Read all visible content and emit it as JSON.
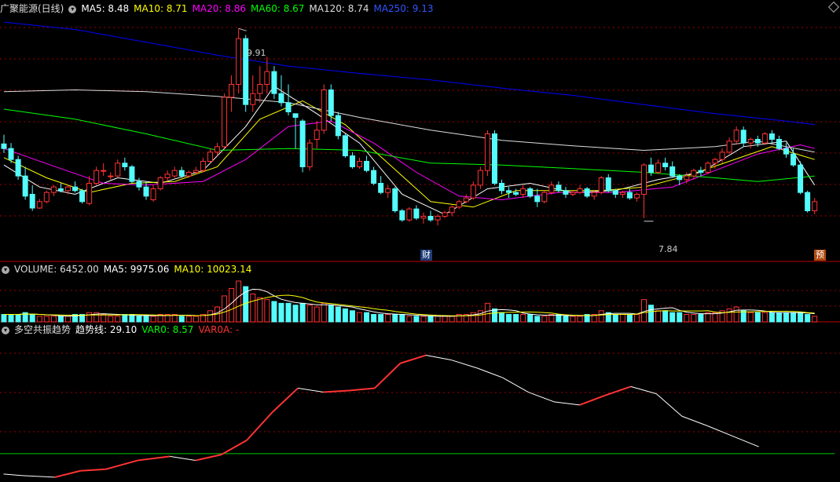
{
  "main_legend": {
    "title": "广聚能源(日线)",
    "ma5": "MA5: 8.48",
    "ma10": "MA10: 8.71",
    "ma20": "MA20: 8.86",
    "ma60": "MA60: 8.67",
    "ma120": "MA120: 8.74",
    "ma250": "MA250: 9.13"
  },
  "volume_legend": {
    "volume": "VOLUME: 6452.00",
    "ma5": "MA5: 9975.06",
    "ma10": "MA10: 10023.14"
  },
  "indicator_legend": {
    "name": "多空共振趋势",
    "trend": "趋势线: 29.10",
    "var0": "VAR0: 8.57",
    "var0a": "VAR0A: -"
  },
  "annotations": {
    "high": "9.91",
    "low": "7.84",
    "badge_cai": "财",
    "badge_yu": "预"
  },
  "colors": {
    "up": "#ff3333",
    "down": "#54fcfc",
    "ma5": "#ffffff",
    "ma10": "#ffff00",
    "ma20": "#ff00ff",
    "ma60": "#00ff00",
    "ma120": "#dddddd",
    "ma250": "#0000ff",
    "grid": "#a00000",
    "border": "#c00000"
  },
  "chart_data": [
    {
      "type": "candlestick",
      "price_range": [
        7.65,
        10.05
      ],
      "ohlc": [
        [
          8.65,
          8.75,
          8.55,
          8.6
        ],
        [
          8.6,
          8.66,
          8.44,
          8.48
        ],
        [
          8.48,
          8.52,
          8.26,
          8.3
        ],
        [
          8.3,
          8.4,
          8.04,
          8.08
        ],
        [
          8.1,
          8.2,
          7.92,
          7.95
        ],
        [
          7.95,
          8.05,
          7.94,
          8.02
        ],
        [
          8.02,
          8.14,
          8.0,
          8.12
        ],
        [
          8.12,
          8.2,
          8.08,
          8.18
        ],
        [
          8.16,
          8.22,
          8.12,
          8.14
        ],
        [
          8.14,
          8.2,
          8.1,
          8.18
        ],
        [
          8.18,
          8.24,
          8.12,
          8.14
        ],
        [
          8.14,
          8.16,
          8.0,
          8.02
        ],
        [
          8.0,
          8.3,
          7.98,
          8.22
        ],
        [
          8.22,
          8.4,
          8.2,
          8.36
        ],
        [
          8.36,
          8.44,
          8.3,
          8.36
        ],
        [
          8.3,
          8.34,
          8.26,
          8.3
        ],
        [
          8.3,
          8.48,
          8.28,
          8.44
        ],
        [
          8.44,
          8.5,
          8.36,
          8.4
        ],
        [
          8.4,
          8.42,
          8.22,
          8.24
        ],
        [
          8.24,
          8.28,
          8.14,
          8.18
        ],
        [
          8.18,
          8.24,
          8.04,
          8.08
        ],
        [
          8.04,
          8.2,
          8.02,
          8.16
        ],
        [
          8.16,
          8.3,
          8.14,
          8.28
        ],
        [
          8.28,
          8.36,
          8.24,
          8.32
        ],
        [
          8.3,
          8.4,
          8.28,
          8.36
        ],
        [
          8.36,
          8.4,
          8.28,
          8.3
        ],
        [
          8.3,
          8.36,
          8.28,
          8.34
        ],
        [
          8.34,
          8.4,
          8.32,
          8.36
        ],
        [
          8.36,
          8.5,
          8.34,
          8.46
        ],
        [
          8.46,
          8.6,
          8.44,
          8.56
        ],
        [
          8.56,
          8.66,
          8.52,
          8.62
        ],
        [
          8.62,
          9.2,
          8.6,
          9.16
        ],
        [
          9.16,
          9.4,
          9.0,
          9.3
        ],
        [
          9.3,
          9.91,
          9.2,
          9.8
        ],
        [
          9.8,
          9.84,
          9.0,
          9.08
        ],
        [
          9.08,
          9.4,
          9.0,
          9.2
        ],
        [
          9.2,
          9.5,
          9.1,
          9.3
        ],
        [
          9.3,
          9.6,
          9.2,
          9.44
        ],
        [
          9.44,
          9.5,
          9.14,
          9.2
        ],
        [
          9.2,
          9.4,
          9.06,
          9.1
        ],
        [
          9.1,
          9.3,
          8.96,
          9.0
        ],
        [
          8.98,
          8.94,
          8.6,
          8.94
        ],
        [
          8.9,
          8.92,
          8.34,
          8.4
        ],
        [
          8.4,
          8.7,
          8.36,
          8.66
        ],
        [
          8.7,
          8.9,
          8.6,
          8.8
        ],
        [
          8.8,
          9.3,
          8.76,
          9.24
        ],
        [
          9.24,
          9.3,
          8.9,
          8.96
        ],
        [
          8.96,
          9.0,
          8.7,
          8.74
        ],
        [
          8.74,
          8.76,
          8.5,
          8.52
        ],
        [
          8.52,
          8.56,
          8.38,
          8.4
        ],
        [
          8.4,
          8.5,
          8.38,
          8.46
        ],
        [
          8.46,
          8.52,
          8.34,
          8.36
        ],
        [
          8.36,
          8.4,
          8.2,
          8.22
        ],
        [
          8.22,
          8.3,
          8.1,
          8.12
        ],
        [
          8.12,
          8.2,
          8.06,
          8.16
        ],
        [
          8.16,
          8.18,
          7.9,
          7.92
        ],
        [
          7.92,
          7.94,
          7.8,
          7.82
        ],
        [
          7.82,
          7.96,
          7.8,
          7.94
        ],
        [
          7.94,
          7.98,
          7.82,
          7.84
        ],
        [
          7.84,
          7.9,
          7.78,
          7.86
        ],
        [
          7.86,
          7.92,
          7.8,
          7.82
        ],
        [
          7.82,
          7.88,
          7.76,
          7.86
        ],
        [
          7.86,
          7.92,
          7.84,
          7.9
        ],
        [
          7.9,
          7.98,
          7.86,
          7.96
        ],
        [
          7.96,
          8.04,
          7.94,
          8.02
        ],
        [
          8.02,
          8.1,
          8.0,
          8.06
        ],
        [
          8.06,
          8.24,
          8.04,
          8.2
        ],
        [
          8.2,
          8.4,
          8.16,
          8.36
        ],
        [
          8.36,
          8.8,
          8.3,
          8.76
        ],
        [
          8.76,
          8.8,
          8.2,
          8.22
        ],
        [
          8.22,
          8.26,
          8.1,
          8.14
        ],
        [
          8.14,
          8.18,
          8.06,
          8.12
        ],
        [
          8.12,
          8.16,
          8.08,
          8.1
        ],
        [
          8.1,
          8.2,
          8.06,
          8.16
        ],
        [
          8.16,
          8.18,
          8.06,
          8.08
        ],
        [
          8.08,
          8.16,
          7.96,
          8.02
        ],
        [
          8.02,
          8.14,
          8.0,
          8.12
        ],
        [
          8.12,
          8.24,
          8.1,
          8.2
        ],
        [
          8.2,
          8.24,
          8.12,
          8.14
        ],
        [
          8.14,
          8.18,
          8.06,
          8.1
        ],
        [
          8.1,
          8.14,
          8.08,
          8.12
        ],
        [
          8.12,
          8.2,
          8.1,
          8.16
        ],
        [
          8.16,
          8.18,
          8.06,
          8.08
        ],
        [
          8.08,
          8.14,
          8.04,
          8.12
        ],
        [
          8.12,
          8.3,
          8.1,
          8.28
        ],
        [
          8.28,
          8.32,
          8.12,
          8.14
        ],
        [
          8.14,
          8.16,
          8.06,
          8.1
        ],
        [
          8.1,
          8.14,
          8.06,
          8.12
        ],
        [
          8.12,
          8.16,
          8.04,
          8.06
        ],
        [
          8.06,
          8.12,
          8.02,
          8.1
        ],
        [
          8.1,
          8.44,
          7.84,
          8.42
        ],
        [
          8.42,
          8.5,
          8.3,
          8.34
        ],
        [
          8.34,
          8.48,
          8.32,
          8.44
        ],
        [
          8.44,
          8.5,
          8.36,
          8.4
        ],
        [
          8.4,
          8.46,
          8.28,
          8.3
        ],
        [
          8.3,
          8.32,
          8.2,
          8.26
        ],
        [
          8.26,
          8.34,
          8.22,
          8.3
        ],
        [
          8.3,
          8.38,
          8.26,
          8.36
        ],
        [
          8.36,
          8.4,
          8.3,
          8.34
        ],
        [
          8.34,
          8.46,
          8.32,
          8.44
        ],
        [
          8.44,
          8.5,
          8.38,
          8.48
        ],
        [
          8.48,
          8.6,
          8.44,
          8.56
        ],
        [
          8.56,
          8.72,
          8.54,
          8.68
        ],
        [
          8.68,
          8.84,
          8.64,
          8.8
        ],
        [
          8.8,
          8.84,
          8.62,
          8.66
        ],
        [
          8.66,
          8.72,
          8.6,
          8.7
        ],
        [
          8.7,
          8.74,
          8.62,
          8.66
        ],
        [
          8.66,
          8.78,
          8.64,
          8.76
        ],
        [
          8.76,
          8.8,
          8.66,
          8.7
        ],
        [
          8.7,
          8.74,
          8.58,
          8.6
        ],
        [
          8.6,
          8.66,
          8.5,
          8.54
        ],
        [
          8.54,
          8.6,
          8.4,
          8.42
        ],
        [
          8.42,
          8.46,
          8.1,
          8.12
        ],
        [
          8.12,
          8.14,
          7.9,
          7.92
        ],
        [
          7.92,
          8.06,
          7.88,
          8.02
        ]
      ],
      "ma": {
        "ma5": [
          [
            0,
            8.42
          ],
          [
            5,
            8.18
          ],
          [
            10,
            8.1
          ],
          [
            16,
            8.28
          ],
          [
            22,
            8.22
          ],
          [
            28,
            8.36
          ],
          [
            34,
            8.84
          ],
          [
            38,
            9.28
          ],
          [
            44,
            8.98
          ],
          [
            50,
            8.66
          ],
          [
            56,
            8.1
          ],
          [
            62,
            7.88
          ],
          [
            68,
            8.16
          ],
          [
            74,
            8.22
          ],
          [
            80,
            8.12
          ],
          [
            86,
            8.14
          ],
          [
            92,
            8.26
          ],
          [
            98,
            8.34
          ],
          [
            104,
            8.62
          ],
          [
            110,
            8.68
          ],
          [
            114,
            8.2
          ]
        ],
        "ma10": [
          [
            0,
            8.5
          ],
          [
            6,
            8.28
          ],
          [
            12,
            8.12
          ],
          [
            18,
            8.22
          ],
          [
            24,
            8.24
          ],
          [
            30,
            8.4
          ],
          [
            36,
            8.92
          ],
          [
            42,
            9.12
          ],
          [
            48,
            8.86
          ],
          [
            54,
            8.44
          ],
          [
            60,
            8.02
          ],
          [
            66,
            7.96
          ],
          [
            72,
            8.14
          ],
          [
            78,
            8.14
          ],
          [
            84,
            8.14
          ],
          [
            90,
            8.18
          ],
          [
            96,
            8.3
          ],
          [
            102,
            8.46
          ],
          [
            108,
            8.62
          ],
          [
            114,
            8.48
          ]
        ],
        "ma20": [
          [
            0,
            8.6
          ],
          [
            8,
            8.38
          ],
          [
            14,
            8.22
          ],
          [
            20,
            8.2
          ],
          [
            28,
            8.24
          ],
          [
            34,
            8.48
          ],
          [
            40,
            8.84
          ],
          [
            46,
            8.9
          ],
          [
            52,
            8.66
          ],
          [
            58,
            8.34
          ],
          [
            64,
            8.08
          ],
          [
            70,
            8.04
          ],
          [
            78,
            8.12
          ],
          [
            86,
            8.12
          ],
          [
            94,
            8.18
          ],
          [
            100,
            8.36
          ],
          [
            106,
            8.54
          ],
          [
            112,
            8.64
          ],
          [
            114,
            8.6
          ]
        ],
        "ma60": [
          [
            0,
            9.03
          ],
          [
            10,
            8.92
          ],
          [
            20,
            8.76
          ],
          [
            30,
            8.58
          ],
          [
            40,
            8.6
          ],
          [
            50,
            8.58
          ],
          [
            60,
            8.44
          ],
          [
            70,
            8.42
          ],
          [
            80,
            8.38
          ],
          [
            90,
            8.34
          ],
          [
            100,
            8.28
          ],
          [
            106,
            8.24
          ],
          [
            114,
            8.3
          ]
        ],
        "ma120": [
          [
            0,
            9.22
          ],
          [
            10,
            9.24
          ],
          [
            20,
            9.22
          ],
          [
            30,
            9.17
          ],
          [
            40,
            9.1
          ],
          [
            50,
            8.94
          ],
          [
            60,
            8.8
          ],
          [
            70,
            8.69
          ],
          [
            80,
            8.63
          ],
          [
            90,
            8.58
          ],
          [
            100,
            8.62
          ],
          [
            106,
            8.68
          ],
          [
            114,
            8.56
          ]
        ],
        "ma250": [
          [
            0,
            9.98
          ],
          [
            10,
            9.9
          ],
          [
            20,
            9.76
          ],
          [
            30,
            9.62
          ],
          [
            40,
            9.5
          ],
          [
            50,
            9.42
          ],
          [
            60,
            9.35
          ],
          [
            70,
            9.26
          ],
          [
            80,
            9.18
          ],
          [
            90,
            9.08
          ],
          [
            100,
            8.98
          ],
          [
            110,
            8.9
          ],
          [
            114,
            8.86
          ]
        ]
      }
    },
    {
      "type": "bar",
      "volume_range": [
        0,
        30000
      ],
      "volume": [
        4,
        4,
        4,
        5,
        4,
        3,
        3,
        3,
        3,
        3,
        4,
        4,
        5,
        5,
        4,
        3,
        3,
        4,
        4,
        3,
        3,
        3,
        4,
        4,
        4,
        3,
        3,
        3,
        4,
        6,
        8,
        14,
        18,
        22,
        19,
        15,
        13,
        12,
        11,
        10,
        10,
        9,
        10,
        9,
        8,
        10,
        9,
        8,
        7,
        6,
        5,
        5,
        4,
        4,
        4,
        4,
        4,
        3,
        3,
        3,
        3,
        3,
        3,
        3,
        4,
        4,
        5,
        6,
        10,
        7,
        5,
        4,
        4,
        4,
        4,
        3,
        3,
        4,
        4,
        3,
        3,
        3,
        4,
        4,
        6,
        5,
        4,
        4,
        4,
        4,
        12,
        9,
        6,
        6,
        5,
        5,
        4,
        4,
        4,
        5,
        5,
        6,
        7,
        8,
        6,
        5,
        5,
        5,
        5,
        5,
        5,
        5,
        5,
        4,
        3
      ]
    },
    {
      "type": "line",
      "series": [
        {
          "name": "趋势线",
          "values": [
            [
              0,
              8
            ],
            [
              3,
              6
            ],
            [
              8,
              4
            ],
            [
              12,
              12
            ],
            [
              16,
              14
            ],
            [
              21,
              25
            ],
            [
              26,
              30
            ],
            [
              30,
              25
            ],
            [
              34,
              32
            ],
            [
              38,
              50
            ],
            [
              42,
              85
            ],
            [
              46,
              115
            ],
            [
              50,
              110
            ],
            [
              54,
              112
            ],
            [
              58,
              115
            ],
            [
              62,
              146
            ],
            [
              66,
              156
            ],
            [
              70,
              150
            ],
            [
              74,
              140
            ],
            [
              78,
              128
            ],
            [
              82,
              110
            ],
            [
              86,
              98
            ],
            [
              90,
              94
            ],
            [
              94,
              106
            ],
            [
              98,
              117
            ],
            [
              102,
              108
            ],
            [
              106,
              80
            ],
            [
              110,
              68
            ],
            [
              114,
              55
            ],
            [
              118,
              42
            ]
          ]
        }
      ],
      "var0": 8.57
    }
  ]
}
